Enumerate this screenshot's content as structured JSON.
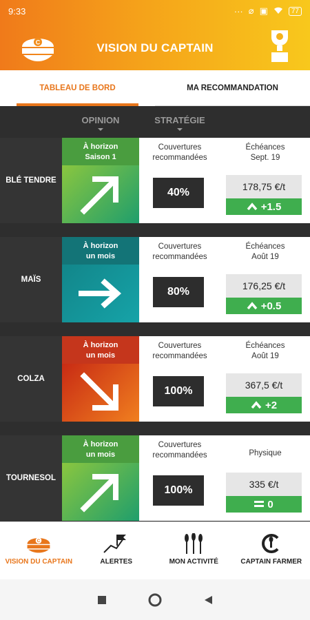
{
  "status_bar": {
    "time": "9:33",
    "battery": "77"
  },
  "app": {
    "title": "VISION DU CAPTAIN"
  },
  "tabs": [
    {
      "label": "TABLEAU DE BORD",
      "active": true
    },
    {
      "label": "MA RECOMMANDATION",
      "active": false
    }
  ],
  "columns": {
    "opinion": "OPINION",
    "strategie": "STRATÉGIE"
  },
  "rows": [
    {
      "name": "BLÉ TENDRE",
      "horizon": [
        "À horizon",
        "Saison 1"
      ],
      "arrow": "up-right",
      "colors": {
        "top": "#4a9d3f",
        "body_from": "#8ac63f",
        "body_to": "#1f9e6c"
      },
      "couvertures_label": [
        "Couvertures",
        "recommandées"
      ],
      "couverture_value": "40%",
      "echeance_label": [
        "Échéances",
        "Sept. 19"
      ],
      "price": "178,75 €/t",
      "delta_icon": "chevron-up",
      "delta": "+1.5"
    },
    {
      "name": "MAÏS",
      "horizon": [
        "À horizon",
        "un mois"
      ],
      "arrow": "right",
      "colors": {
        "top": "#137477",
        "body_from": "#12868a",
        "body_to": "#16a3a8"
      },
      "couvertures_label": [
        "Couvertures",
        "recommandées"
      ],
      "couverture_value": "80%",
      "echeance_label": [
        "Échéances",
        "Août 19"
      ],
      "price": "176,25 €/t",
      "delta_icon": "chevron-up",
      "delta": "+0.5"
    },
    {
      "name": "COLZA",
      "horizon": [
        "À horizon",
        "un mois"
      ],
      "arrow": "down-right",
      "colors": {
        "top": "#c5361c",
        "body_from": "#c82b14",
        "body_to": "#f07f1f"
      },
      "couvertures_label": [
        "Couvertures",
        "recommandées"
      ],
      "couverture_value": "100%",
      "echeance_label": [
        "Échéances",
        "Août 19"
      ],
      "price": "367,5 €/t",
      "delta_icon": "chevron-up",
      "delta": "+2"
    },
    {
      "name": "TOURNESOL",
      "horizon": [
        "À horizon",
        "un mois"
      ],
      "arrow": "up-right",
      "colors": {
        "top": "#4a9d3f",
        "body_from": "#8ac63f",
        "body_to": "#1f9e6c"
      },
      "couvertures_label": [
        "Couvertures",
        "recommandées"
      ],
      "couverture_value": "100%",
      "echeance_label": [
        "Physique"
      ],
      "price": "335 €/t",
      "delta_icon": "equals",
      "delta": "0"
    }
  ],
  "bottom_nav": [
    {
      "label": "VISION DU CAPTAIN",
      "icon": "captain-hat-icon",
      "active": true
    },
    {
      "label": "ALERTES",
      "icon": "alert-chart-icon",
      "active": false
    },
    {
      "label": "MON ACTIVITÉ",
      "icon": "wheat-icon",
      "active": false
    },
    {
      "label": "CAPTAIN FARMER",
      "icon": "captain-farmer-logo-icon",
      "active": false
    }
  ],
  "accent_color": "#e8761b",
  "positive_color": "#3fae4e"
}
